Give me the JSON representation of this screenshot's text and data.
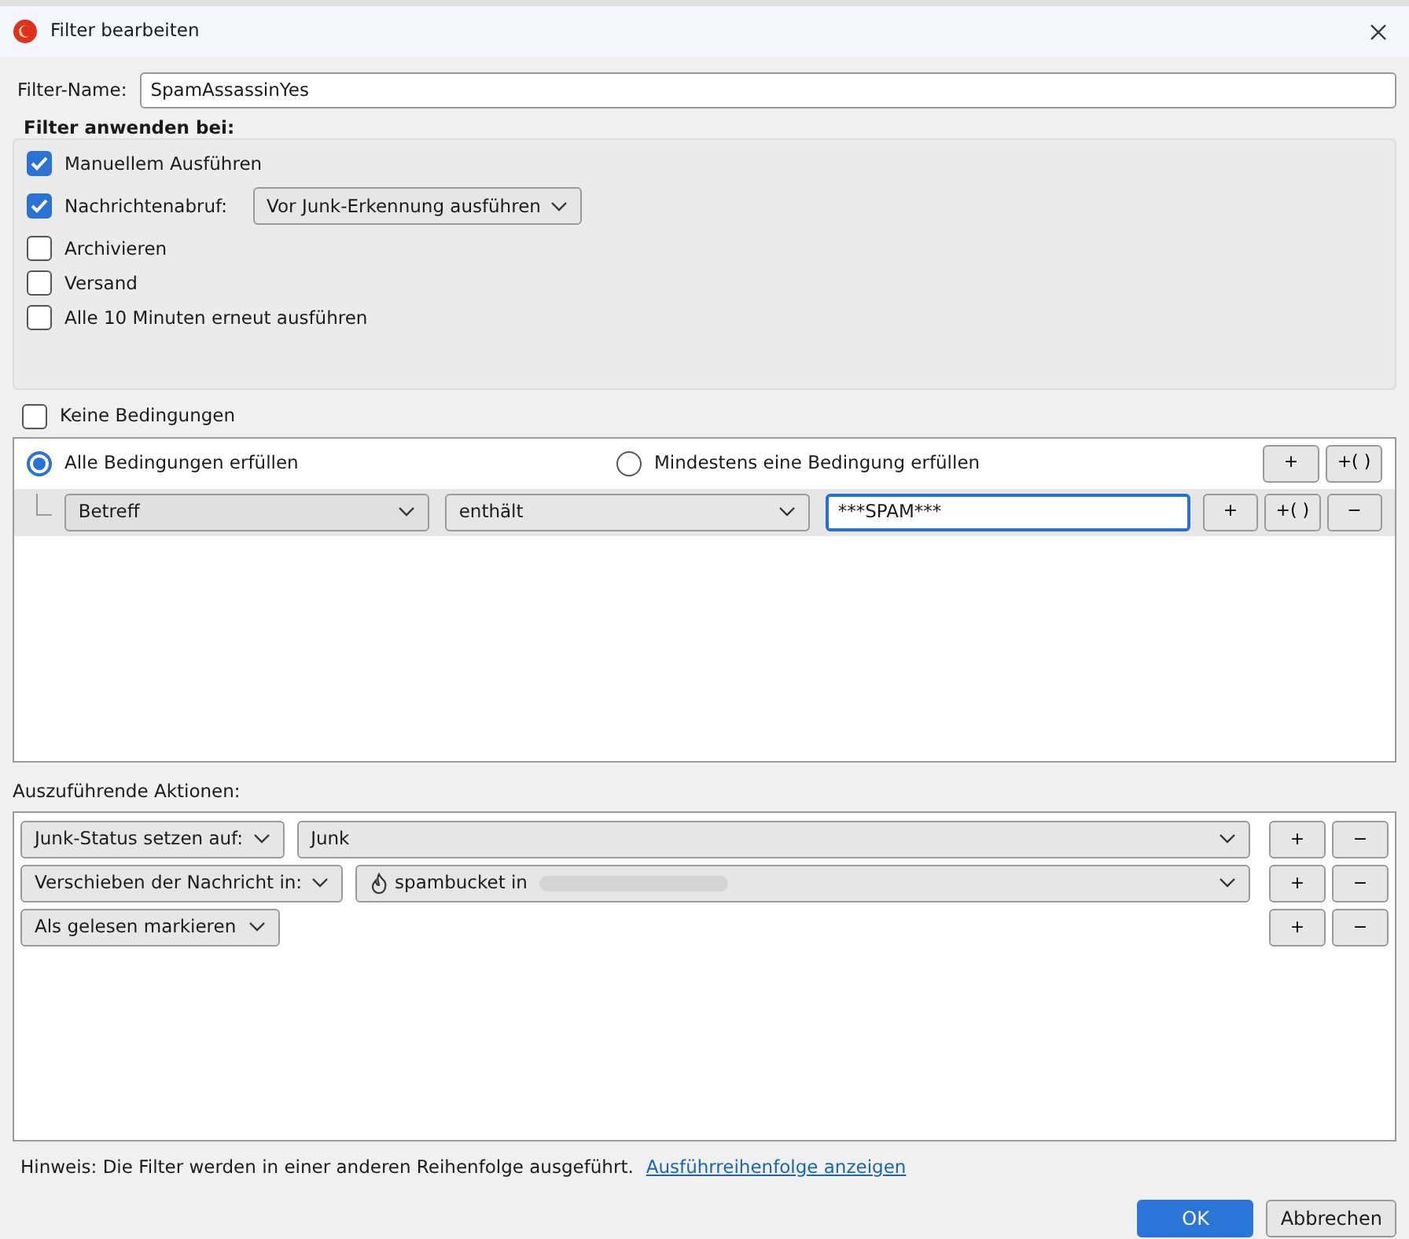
{
  "window": {
    "title": "Filter bearbeiten"
  },
  "filter_name": {
    "label": "Filter-Name:",
    "value": "SpamAssassinYes"
  },
  "apply": {
    "title": "Filter anwenden bei:",
    "options": [
      {
        "label": "Manuellem Ausführen",
        "checked": true
      },
      {
        "label": "Nachrichtenabruf:",
        "checked": true,
        "dropdown": "Vor Junk-Erkennung ausführen"
      },
      {
        "label": "Archivieren",
        "checked": false
      },
      {
        "label": "Versand",
        "checked": false
      },
      {
        "label": "Alle 10 Minuten erneut ausführen",
        "checked": false
      }
    ]
  },
  "no_conditions": {
    "label": "Keine Bedingungen",
    "checked": false
  },
  "match": [
    {
      "label": "Alle Bedingungen erfüllen",
      "selected": true
    },
    {
      "label": "Mindestens eine Bedingung erfüllen",
      "selected": false
    }
  ],
  "match_buttons": [
    "+",
    "+( )"
  ],
  "conditions": [
    {
      "field": "Betreff",
      "operator": "enthält",
      "value": "***SPAM***",
      "buttons": [
        "+",
        "+( )",
        "−"
      ]
    }
  ],
  "actions_label": "Auszuführende Aktionen:",
  "actions": [
    {
      "kind": "select",
      "action": "Junk-Status setzen auf:",
      "target": "Junk",
      "buttons": [
        "+",
        "−"
      ]
    },
    {
      "kind": "folder",
      "action": "Verschieben der Nachricht in:",
      "target": "spambucket in",
      "redacted": true,
      "buttons": [
        "+",
        "−"
      ]
    },
    {
      "kind": "none",
      "action": "Als gelesen markieren",
      "buttons": [
        "+",
        "−"
      ]
    }
  ],
  "hint": {
    "text": "Hinweis: Die Filter werden in einer anderen Reihenfolge ausgeführt.",
    "link": "Ausführreihenfolge anzeigen"
  },
  "buttons": [
    {
      "label": "OK",
      "primary": true
    },
    {
      "label": "Abbrechen",
      "primary": false
    }
  ]
}
